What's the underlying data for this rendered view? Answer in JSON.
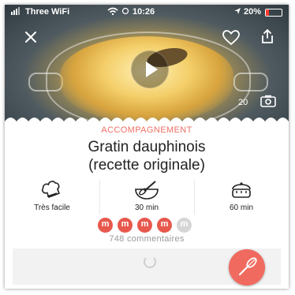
{
  "status_bar": {
    "carrier": "Three WiFi",
    "time": "10:26",
    "battery": "20%"
  },
  "hero": {
    "photo_count": "20"
  },
  "recipe": {
    "category": "ACCOMPAGNEMENT",
    "title_line1": "Gratin dauphinois",
    "title_line2": "(recette originale)",
    "difficulty": "Très facile",
    "prep_time": "30 min",
    "cook_time": "60 min",
    "rating": {
      "filled": 4,
      "total": 5,
      "glyph": "m"
    },
    "comments": "748 commentaires"
  },
  "colors": {
    "accent": "#ef6e63",
    "rating_filled": "#e8584d",
    "rating_empty": "#d6d6d6",
    "fab": "#f06a5f"
  },
  "icons": {
    "close": "close-icon",
    "favorite": "heart-icon",
    "share": "share-icon",
    "play": "play-icon",
    "camera": "camera-icon",
    "difficulty": "chef-hat-icon",
    "prep": "whisk-bowl-icon",
    "cook": "pot-icon",
    "fab": "whisk-icon"
  }
}
